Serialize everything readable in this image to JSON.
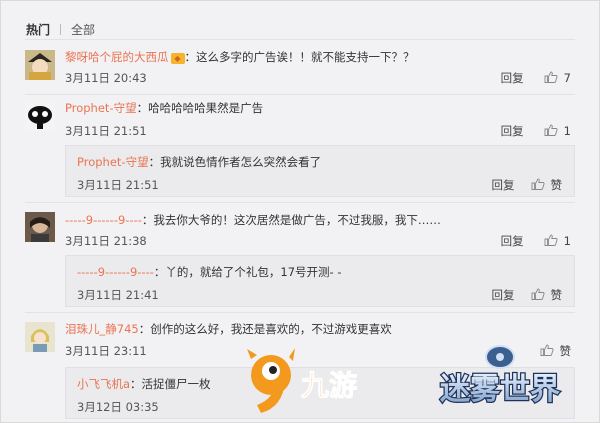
{
  "tabs": {
    "hot": "热门",
    "all": "全部"
  },
  "comments": [
    {
      "user": "黎呀哈个屁的大西瓜",
      "text": "：这么多字的广告诶！！就不能支持一下？？",
      "time": "3月11日 20:43",
      "reply_label": "回复",
      "likes": "7"
    },
    {
      "user": "Prophet-守望",
      "text": "：哈哈哈哈哈果然是广告",
      "time": "3月11日 21:51",
      "reply_label": "回复",
      "likes": "1",
      "sub": {
        "user": "Prophet-守望",
        "text": "：我就说色情作者怎么突然会看了",
        "time": "3月11日 21:51",
        "reply_label": "回复",
        "like_label": "赞"
      }
    },
    {
      "user": "-----9------9----",
      "text": "：我去你大爷的！这次居然是做广告，不过我服，我下……",
      "time": "3月11日 21:38",
      "reply_label": "回复",
      "likes": "1",
      "sub": {
        "user": "-----9------9----",
        "text": "：丫的，就给了个礼包，17号开测- -",
        "time": "3月11日 21:41",
        "reply_label": "回复",
        "like_label": "赞"
      }
    },
    {
      "user": "泪珠儿_静745",
      "text": "：创作的这么好，我还是喜欢的，不过游戏更喜欢",
      "time": "3月11日 23:11",
      "like_label": "赞",
      "sub": {
        "user": "小飞飞机a",
        "text": "：活捉僵尸一枚",
        "time": "3月12日 03:35"
      }
    }
  ],
  "watermarks": {
    "left": "九游",
    "right": "迷雾世界"
  },
  "colors": {
    "username": "#eb7350",
    "background": "#f2f2f5",
    "reply_box": "#ebebee"
  }
}
